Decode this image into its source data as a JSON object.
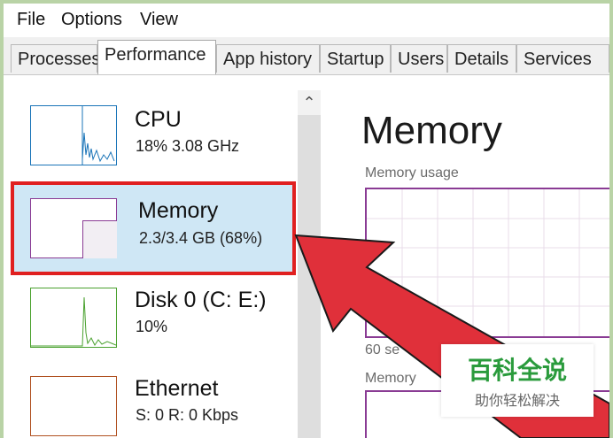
{
  "menu": [
    "File",
    "Options",
    "View"
  ],
  "tabs": [
    "Processes",
    "Performance",
    "App history",
    "Startup",
    "Users",
    "Details",
    "Services"
  ],
  "active_tab": "Performance",
  "sidebar": {
    "items": [
      {
        "name": "CPU",
        "detail": "18%  3.08 GHz",
        "color": "#1a74b8"
      },
      {
        "name": "Memory",
        "detail": "2.3/3.4 GB (68%)",
        "color": "#8a3b94",
        "usage_fraction": 0.68
      },
      {
        "name": "Disk 0 (C: E:)",
        "detail": "10%",
        "color": "#4aa12f"
      },
      {
        "name": "Ethernet",
        "detail": "S: 0  R: 0 Kbps",
        "color": "#b05020"
      }
    ]
  },
  "main": {
    "title": "Memory",
    "usage_label": "Memory usage",
    "time_label": "60 se",
    "composition_label": "Memory"
  },
  "watermark": {
    "title": "百科全说",
    "subtitle": "助你轻松解决"
  },
  "colors": {
    "highlight_bg": "#cfe7f5",
    "highlight_border": "#e02020",
    "arrow": "#e0303a"
  }
}
